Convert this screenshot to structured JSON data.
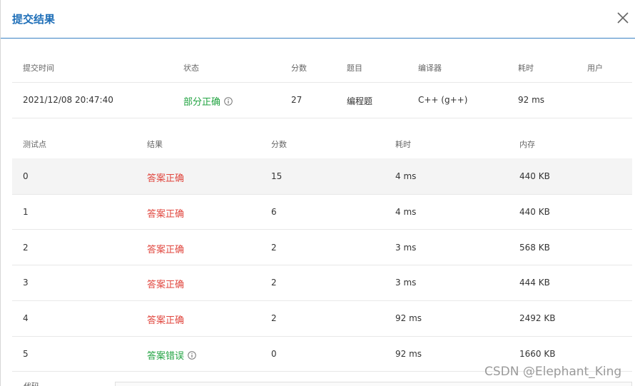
{
  "dialog": {
    "title": "提交结果"
  },
  "submission": {
    "headers": {
      "time": "提交时间",
      "status": "状态",
      "score": "分数",
      "problem": "题目",
      "compiler": "编译器",
      "duration": "耗时",
      "user": "用户"
    },
    "time": "2021/12/08 20:47:40",
    "status": "部分正确",
    "score": "27",
    "problem": "编程题",
    "compiler": "C++ (g++)",
    "duration": "92 ms",
    "user": ""
  },
  "testcases": {
    "headers": {
      "id": "测试点",
      "result": "结果",
      "score": "分数",
      "duration": "耗时",
      "memory": "内存"
    },
    "rows": [
      {
        "id": "0",
        "result": "答案正确",
        "score": "15",
        "duration": "4 ms",
        "memory": "440 KB"
      },
      {
        "id": "1",
        "result": "答案正确",
        "score": "6",
        "duration": "4 ms",
        "memory": "440 KB"
      },
      {
        "id": "2",
        "result": "答案正确",
        "score": "2",
        "duration": "3 ms",
        "memory": "568 KB"
      },
      {
        "id": "3",
        "result": "答案正确",
        "score": "2",
        "duration": "3 ms",
        "memory": "444 KB"
      },
      {
        "id": "4",
        "result": "答案正确",
        "score": "2",
        "duration": "92 ms",
        "memory": "2492 KB"
      },
      {
        "id": "5",
        "result": "答案错误",
        "score": "0",
        "duration": "92 ms",
        "memory": "1660 KB"
      }
    ]
  },
  "bottom": {
    "label": "代码"
  },
  "watermark": "CSDN @Elephant_King",
  "colors": {
    "accent": "#1f6fb8",
    "success": "#21a341",
    "error": "#e0463e"
  }
}
